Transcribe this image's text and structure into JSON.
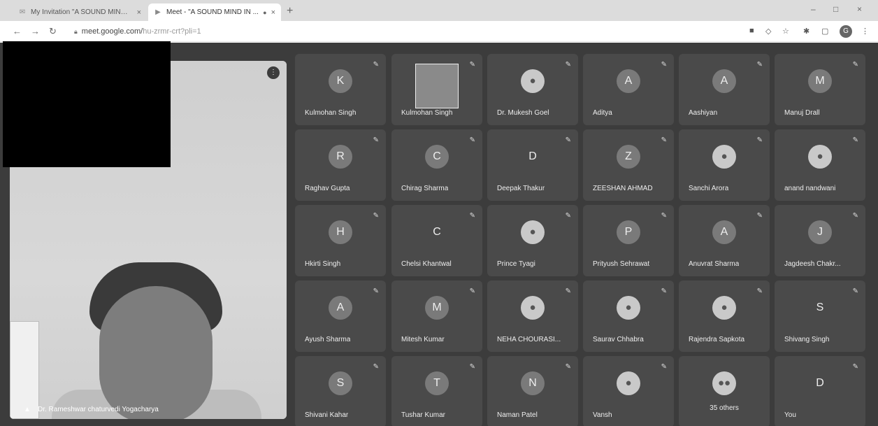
{
  "browser": {
    "tab1_title": "My Invitation \"A SOUND MIND IN ...",
    "tab2_title": "Meet - \"A SOUND MIND IN ...",
    "url_host": "meet.google.com/",
    "url_path": "hu-zrmr-crt?pli=1",
    "profile_initial": "G"
  },
  "speaker": {
    "name": "Dr. Rameshwar chaturvedi Yogacharya"
  },
  "participants": [
    {
      "name": "Kulmohan Singh",
      "initial": "K"
    },
    {
      "name": "Kulmohan Singh",
      "initial": ""
    },
    {
      "name": "Dr. Mukesh Goel",
      "initial": ""
    },
    {
      "name": "Aditya",
      "initial": "A"
    },
    {
      "name": "Aashiyan",
      "initial": "A"
    },
    {
      "name": "Manuj Drall",
      "initial": "M"
    },
    {
      "name": "Raghav Gupta",
      "initial": "R"
    },
    {
      "name": "Chirag Sharma",
      "initial": "C"
    },
    {
      "name": "Deepak Thakur",
      "initial": "D"
    },
    {
      "name": "ZEESHAN AHMAD",
      "initial": "Z"
    },
    {
      "name": "Sanchi Arora",
      "initial": ""
    },
    {
      "name": "anand nandwani",
      "initial": ""
    },
    {
      "name": "Hkirti Singh",
      "initial": "H"
    },
    {
      "name": "Chelsi Khantwal",
      "initial": "C"
    },
    {
      "name": "Prince Tyagi",
      "initial": ""
    },
    {
      "name": "Prityush Sehrawat",
      "initial": "P"
    },
    {
      "name": "Anuvrat Sharma",
      "initial": "A"
    },
    {
      "name": "Jagdeesh Chakr...",
      "initial": "J"
    },
    {
      "name": "Ayush Sharma",
      "initial": "A"
    },
    {
      "name": "Mitesh Kumar",
      "initial": "M"
    },
    {
      "name": "NEHA CHOURASI...",
      "initial": ""
    },
    {
      "name": "Saurav Chhabra",
      "initial": ""
    },
    {
      "name": "Rajendra Sapkota",
      "initial": ""
    },
    {
      "name": "Shivang Singh",
      "initial": "S"
    },
    {
      "name": "Shivani Kahar",
      "initial": "S"
    },
    {
      "name": "Tushar Kumar",
      "initial": "T"
    },
    {
      "name": "Naman Patel",
      "initial": "N"
    },
    {
      "name": "Vansh",
      "initial": ""
    },
    {
      "name": "35 others",
      "initial": ""
    },
    {
      "name": "You",
      "initial": "D"
    }
  ]
}
